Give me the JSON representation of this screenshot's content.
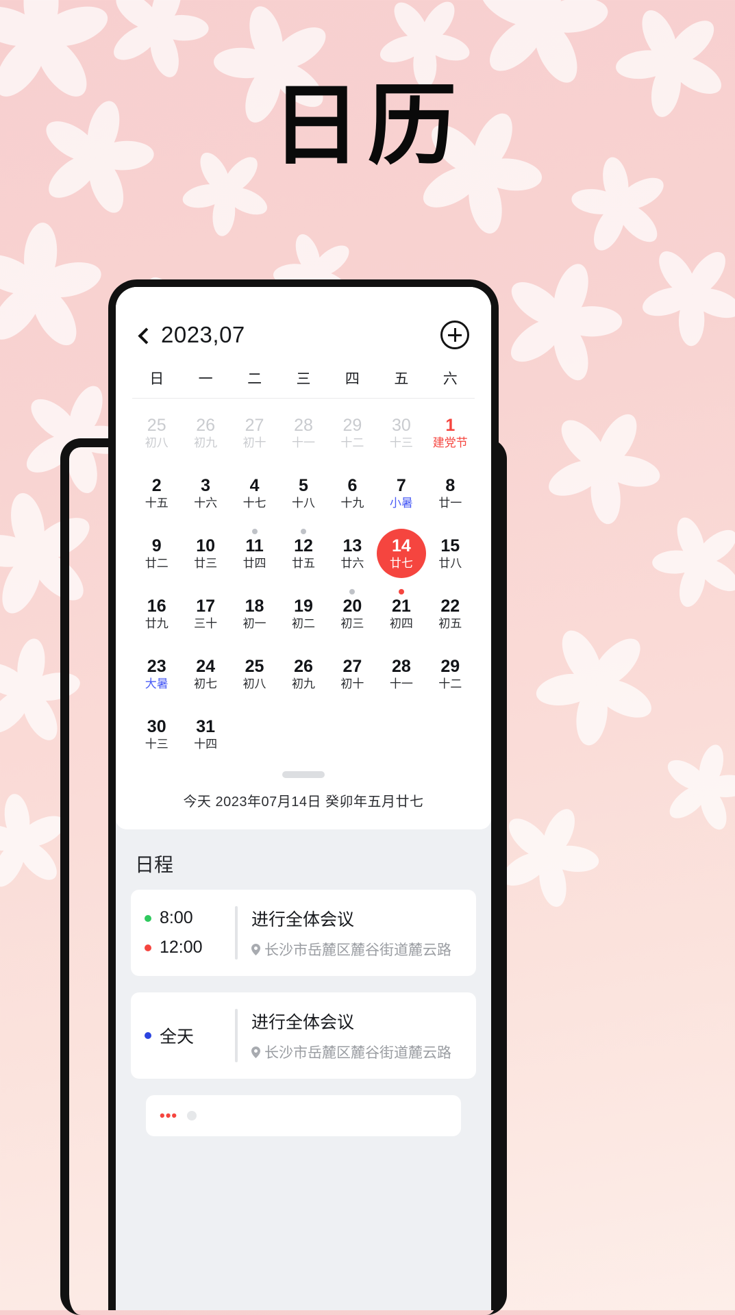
{
  "page": {
    "title": "日历",
    "background_start": "#f7cfcf",
    "background_end": "#fdeee9"
  },
  "calendar": {
    "back_icon": "chevron-left-icon",
    "month_label": "2023,07",
    "add_icon": "plus-circle-icon",
    "weekdays": [
      "日",
      "一",
      "二",
      "三",
      "四",
      "五",
      "六"
    ],
    "accent_color": "#f5453f",
    "term_color": "#4a5cf5",
    "weeks": [
      [
        {
          "num": "25",
          "lunar": "初八",
          "state": "out"
        },
        {
          "num": "26",
          "lunar": "初九",
          "state": "out"
        },
        {
          "num": "27",
          "lunar": "初十",
          "state": "out"
        },
        {
          "num": "28",
          "lunar": "十一",
          "state": "out"
        },
        {
          "num": "29",
          "lunar": "十二",
          "state": "out"
        },
        {
          "num": "30",
          "lunar": "十三",
          "state": "out"
        },
        {
          "num": "1",
          "lunar": "建党节",
          "state": "holiday"
        }
      ],
      [
        {
          "num": "2",
          "lunar": "十五",
          "state": "normal"
        },
        {
          "num": "3",
          "lunar": "十六",
          "state": "normal"
        },
        {
          "num": "4",
          "lunar": "十七",
          "state": "normal"
        },
        {
          "num": "5",
          "lunar": "十八",
          "state": "normal"
        },
        {
          "num": "6",
          "lunar": "十九",
          "state": "normal"
        },
        {
          "num": "7",
          "lunar": "小暑",
          "state": "term"
        },
        {
          "num": "8",
          "lunar": "廿一",
          "state": "normal"
        }
      ],
      [
        {
          "num": "9",
          "lunar": "廿二",
          "state": "normal"
        },
        {
          "num": "10",
          "lunar": "廿三",
          "state": "normal"
        },
        {
          "num": "11",
          "lunar": "廿四",
          "state": "normal",
          "mark": "grey"
        },
        {
          "num": "12",
          "lunar": "廿五",
          "state": "normal",
          "mark": "grey"
        },
        {
          "num": "13",
          "lunar": "廿六",
          "state": "normal"
        },
        {
          "num": "14",
          "lunar": "廿七",
          "state": "selected"
        },
        {
          "num": "15",
          "lunar": "廿八",
          "state": "normal"
        }
      ],
      [
        {
          "num": "16",
          "lunar": "廿九",
          "state": "normal"
        },
        {
          "num": "17",
          "lunar": "三十",
          "state": "normal"
        },
        {
          "num": "18",
          "lunar": "初一",
          "state": "normal"
        },
        {
          "num": "19",
          "lunar": "初二",
          "state": "normal"
        },
        {
          "num": "20",
          "lunar": "初三",
          "state": "normal",
          "mark": "grey"
        },
        {
          "num": "21",
          "lunar": "初四",
          "state": "normal",
          "mark": "red"
        },
        {
          "num": "22",
          "lunar": "初五",
          "state": "normal"
        }
      ],
      [
        {
          "num": "23",
          "lunar": "大暑",
          "state": "term"
        },
        {
          "num": "24",
          "lunar": "初七",
          "state": "normal"
        },
        {
          "num": "25",
          "lunar": "初八",
          "state": "normal"
        },
        {
          "num": "26",
          "lunar": "初九",
          "state": "normal"
        },
        {
          "num": "27",
          "lunar": "初十",
          "state": "normal"
        },
        {
          "num": "28",
          "lunar": "十一",
          "state": "normal"
        },
        {
          "num": "29",
          "lunar": "十二",
          "state": "normal"
        }
      ],
      [
        {
          "num": "30",
          "lunar": "十三",
          "state": "normal"
        },
        {
          "num": "31",
          "lunar": "十四",
          "state": "normal"
        },
        {
          "num": "",
          "lunar": "",
          "state": "empty"
        },
        {
          "num": "",
          "lunar": "",
          "state": "empty"
        },
        {
          "num": "",
          "lunar": "",
          "state": "empty"
        },
        {
          "num": "",
          "lunar": "",
          "state": "empty"
        },
        {
          "num": "",
          "lunar": "",
          "state": "empty"
        }
      ]
    ],
    "today_line": "今天 2023年07月14日  癸卯年五月廿七"
  },
  "schedule": {
    "title": "日程",
    "events": [
      {
        "times": [
          {
            "label": "8:00",
            "dot_color": "#2fc95e"
          },
          {
            "label": "12:00",
            "dot_color": "#f5453f"
          }
        ],
        "title": "进行全体会议",
        "location_icon": "map-pin-icon",
        "location": "长沙市岳麓区麓谷街道麓云路"
      },
      {
        "times": [
          {
            "label": "全天",
            "dot_color": "#2b44e0"
          }
        ],
        "title": "进行全体会议",
        "location_icon": "map-pin-icon",
        "location": "长沙市岳麓区麓谷街道麓云路"
      }
    ]
  }
}
